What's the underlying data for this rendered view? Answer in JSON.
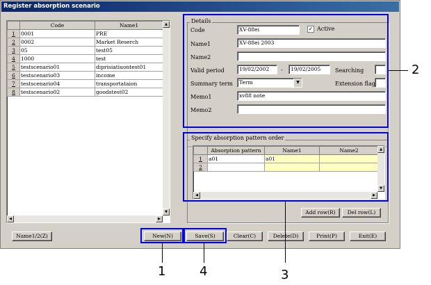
{
  "window": {
    "title": "Register absorption scenario"
  },
  "scenario_list": {
    "columns": [
      "",
      "Code",
      "Name1"
    ],
    "rows": [
      {
        "n": "1",
        "code": "0001",
        "name": "PRE"
      },
      {
        "n": "2",
        "code": "0002",
        "name": "Market Reserch"
      },
      {
        "n": "3",
        "code": "05",
        "name": "test05"
      },
      {
        "n": "4",
        "code": "1000",
        "name": "test"
      },
      {
        "n": "5",
        "code": "testscenario01",
        "name": "diprisiatiuontest01"
      },
      {
        "n": "6",
        "code": "testscenario03",
        "name": "income"
      },
      {
        "n": "7",
        "code": "testscenario04",
        "name": "transportataion"
      },
      {
        "n": "8",
        "code": "testscenario02",
        "name": "goodstest02"
      }
    ]
  },
  "details": {
    "group_label": "Details",
    "code_label": "Code",
    "code_value": "XV-88ei",
    "active_label": "Active",
    "active_checked": true,
    "name1_label": "Name1",
    "name1_value": "XV-88ei 2003",
    "name2_label": "Name2",
    "name2_value": "",
    "valid_period_label": "Valid period",
    "valid_from": "19/02/2002",
    "period_dash": "-",
    "valid_to": "19/02/2005",
    "searching_label": "Searching",
    "searching_value": "",
    "summary_term_label": "Summary term",
    "summary_term_value": "Term",
    "extension_flag_label": "Extension flag",
    "extension_flag_value": "",
    "memo1_label": "Memo1",
    "memo1_value": "xv88 note",
    "memo2_label": "Memo2",
    "memo2_value": ""
  },
  "pattern": {
    "group_label": "Specify absorption pattern order",
    "columns": [
      "",
      "Absorption pattern",
      "Name1",
      "Name2"
    ],
    "rows": [
      {
        "n": "1",
        "pattern": "a01",
        "name1": "a01",
        "name2": ""
      },
      {
        "n": "2",
        "pattern": "",
        "name1": "",
        "name2": ""
      }
    ],
    "add_row_label": "Add row(R)",
    "del_row_label": "Del row(L)"
  },
  "buttons": {
    "name12": "Name1/2(Z)",
    "new": "New(N)",
    "save": "Save(S)",
    "clear": "Clear(C)",
    "delete": "Delete(D)",
    "print": "Print(P)",
    "exit": "Exit(E)"
  },
  "callouts": {
    "c1": "1",
    "c2": "2",
    "c3": "3",
    "c4": "4"
  },
  "colors": {
    "callout": "#0000e6",
    "titlebar": "#0a246a",
    "window": "#d4d0c8",
    "highlight_cell": "#ffffc0"
  }
}
